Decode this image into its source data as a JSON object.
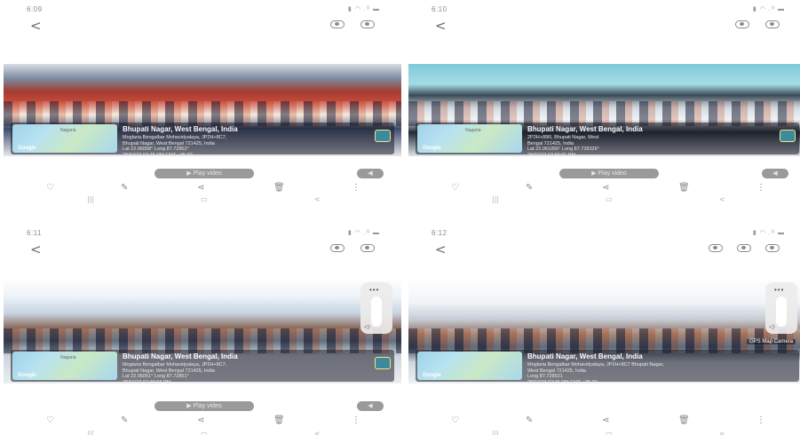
{
  "screenshots": [
    {
      "status_time": "6:09",
      "status_icons": "▮ ◠ .ᴵᴵ ▬",
      "geo_title": "Bhupati Nagar, West Bengal, India",
      "geo_lines": "Moglaria Bengalbar Mohavidyalaya, JP2H+8C7,\nBhupati Nagar, West Bengal 721425, India\nLat 22.06058° Long 87.72852°\n28/07/23 02:35 PM GMT +05:30",
      "map_place": "Nagaria",
      "map_label": "Google",
      "play_label": "▶ Play video"
    },
    {
      "status_time": "6:10",
      "status_icons": "▮ ◠ .ᴵᴵ ▬",
      "geo_title": "Bhupati Nagar, West Bengal, India",
      "geo_lines": "2P2H+89R, Bhupati Nagar, West\nBengal 721425, India\nLat 22.061056° Long 87.728326°\n28/07/23 02:50:31 PM",
      "map_place": "Nagaria",
      "map_label": "Google",
      "play_label": "▶ Play video"
    },
    {
      "status_time": "6:11",
      "status_icons": "▮ ◠ .ᴵᴵ ▬",
      "geo_title": "Bhupati Nagar, West Bengal, India",
      "geo_lines": "Moglaria Bengalbar Mohavidyalaya, JP2H+8C7,\nBhupati Nagar, West Bengal 721425, India\nLat 22.06061° Long 87.72851°\n28/07/23 02:38:58 PM",
      "map_place": "Nagaria",
      "map_label": "Google",
      "play_label": "▶ Play video"
    },
    {
      "status_time": "6:12",
      "status_icons": "▮ ◠ .ᴵᴵ ▬",
      "geo_title": "Bhupati Nagar, West Bengal, India",
      "geo_lines": "Moglaria Bengalbar Mohavidyalaya, JP2H+8C7 Bhupati Nagar,\nWest Bengal 721425, India\nLong 87.728521\n28/07/23 02:36 PM GMT +05:30",
      "map_place": "",
      "map_label": "Google",
      "gps_tag": "GPS Map Camera",
      "play_label": ""
    }
  ],
  "icons": {
    "back": "<",
    "heart": "♡",
    "edit": "✎",
    "share": "⋖",
    "delete": "🗑",
    "more": "⋮",
    "nav_recent": "|||",
    "nav_home": "▭",
    "nav_back": "<",
    "vol_dots": "•••",
    "vol_speaker": "◁·"
  }
}
